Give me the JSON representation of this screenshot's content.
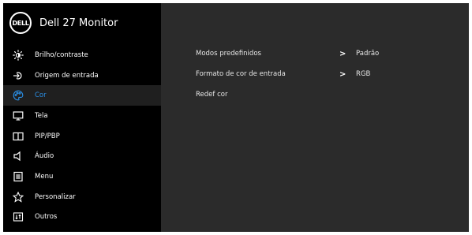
{
  "header": {
    "logo_text": "DELL",
    "title": "Dell 27 Monitor"
  },
  "sidebar": {
    "items": [
      {
        "label": "Brilho/contraste",
        "icon": "brightness-icon",
        "active": false
      },
      {
        "label": "Origem de entrada",
        "icon": "input-source-icon",
        "active": false
      },
      {
        "label": "Cor",
        "icon": "palette-icon",
        "active": true
      },
      {
        "label": "Tela",
        "icon": "display-icon",
        "active": false
      },
      {
        "label": "PIP/PBP",
        "icon": "pip-pbp-icon",
        "active": false
      },
      {
        "label": "Áudio",
        "icon": "audio-icon",
        "active": false
      },
      {
        "label": "Menu",
        "icon": "menu-icon",
        "active": false
      },
      {
        "label": "Personalizar",
        "icon": "star-icon",
        "active": false
      },
      {
        "label": "Outros",
        "icon": "others-icon",
        "active": false
      }
    ]
  },
  "content": {
    "rows": [
      {
        "label": "Modos predefinidos",
        "chevron": ">",
        "value": "Padrão"
      },
      {
        "label": "Formato de cor de entrada",
        "chevron": ">",
        "value": "RGB"
      },
      {
        "label": "Redef cor",
        "chevron": "",
        "value": ""
      }
    ]
  },
  "colors": {
    "accent": "#2a8fe6",
    "sidebar_bg": "#000000",
    "content_bg": "#2b2b2b",
    "active_bg": "#1f1f1f"
  }
}
